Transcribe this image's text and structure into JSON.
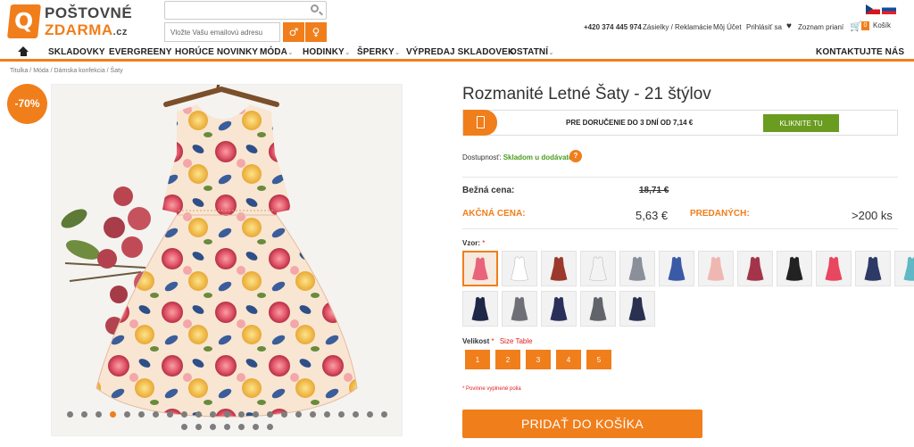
{
  "header": {
    "logo_line1": "POŠTOVNÉ",
    "logo_line2": "ZDARMA",
    "logo_tld": ".cz",
    "search_placeholder": "",
    "newsletter_placeholder": "Vložte Vašu emailovú adresu",
    "male_symbol": "♂",
    "female_symbol": "♀",
    "phone": "+420 374 445 974",
    "links": [
      "Zásielky / Reklamácie",
      "Môj Účet",
      "Prihlásiť sa",
      "Zoznam prianí"
    ],
    "cart_count": "0",
    "cart_label": "Košík"
  },
  "nav": {
    "items": [
      "SKLADOVKY",
      "EVERGREENY",
      "HORÚCE NOVINKY",
      "MÓDA",
      "HODINKY",
      "ŠPERKY",
      "VÝPREDAJ SKLADOVEK",
      "OSTATNÍ"
    ],
    "contact": "KONTAKTUJTE NÁS"
  },
  "breadcrumb": "Titulka  /  Móda  /  Dámska konfekcia  /  Šaty",
  "gallery": {
    "discount": "-70%",
    "dot_count": 30,
    "active_dot": 3
  },
  "product": {
    "title": "Rozmanité Letné Šaty - 21 štýlov",
    "delivery_text": "PRE DORUČENIE DO 3 DNÍ OD 7,14 €",
    "delivery_button": "KLIKNITE TU",
    "availability_label": "Dostupnosť:",
    "availability_value": "Skladom u dodávateľa",
    "help": "?",
    "regular_price_label": "Bežná cena:",
    "regular_price": "18,71 €",
    "sale_price_label": "AKČNÁ CENA:",
    "sale_price": "5,63 €",
    "sold_label": "PREDANÝCH:",
    "sold_value": ">200 ks",
    "pattern_label": "Vzor:",
    "required_mark": "*",
    "size_label": "Velikost",
    "size_table": "Size Table",
    "sizes": [
      "1",
      "2",
      "3",
      "4",
      "5"
    ],
    "required_note": "* Povinne vyplnené polia",
    "add_to_cart": "PRIDAŤ DO KOŠÍKA"
  },
  "colors": {
    "accent": "#f07e1b",
    "green": "#6a9c1f",
    "stock_green": "#4a9c20",
    "required_red": "#e02020"
  },
  "swatches": [
    {
      "bg": "#f6eadf",
      "fg": "#e9647a"
    },
    {
      "bg": "#f2f2f2",
      "fg": "#ffffff"
    },
    {
      "bg": "#f2f2f2",
      "fg": "#9b3a2c"
    },
    {
      "bg": "#f2f2f2",
      "fg": "#f3f3f3"
    },
    {
      "bg": "#f2f2f2",
      "fg": "#8a8f9a"
    },
    {
      "bg": "#f2f2f2",
      "fg": "#3a5aa8"
    },
    {
      "bg": "#f2f2f2",
      "fg": "#f0b7b2"
    },
    {
      "bg": "#f2f2f2",
      "fg": "#a3344a"
    },
    {
      "bg": "#f2f2f2",
      "fg": "#222222"
    },
    {
      "bg": "#f2f2f2",
      "fg": "#e94660"
    },
    {
      "bg": "#f2f2f2",
      "fg": "#2d3a66"
    },
    {
      "bg": "#f2f2f2",
      "fg": "#5fb8c4"
    },
    {
      "bg": "#f2f2f2",
      "fg": "#1e2747"
    },
    {
      "bg": "#f2f2f2",
      "fg": "#6f6f78"
    },
    {
      "bg": "#f2f2f2",
      "fg": "#2a2f5a"
    },
    {
      "bg": "#f2f2f2",
      "fg": "#62646c"
    },
    {
      "bg": "#f2f2f2",
      "fg": "#2a3050"
    }
  ]
}
